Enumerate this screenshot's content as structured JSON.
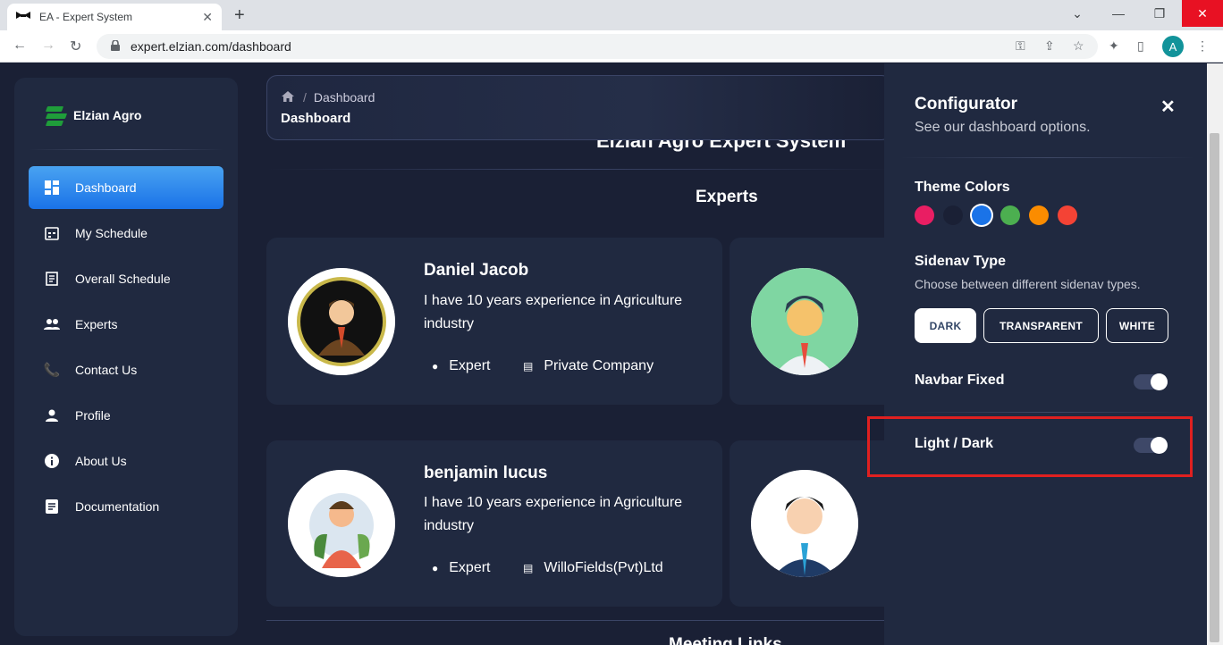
{
  "browser": {
    "tab_title": "EA - Expert System",
    "url": "expert.elzian.com/dashboard",
    "profile_initial": "A"
  },
  "brand": {
    "name": "Elzian Agro"
  },
  "sidebar": {
    "items": [
      {
        "label": "Dashboard",
        "icon": "dashboard-icon",
        "active": true
      },
      {
        "label": "My Schedule",
        "icon": "calendar-icon"
      },
      {
        "label": "Overall Schedule",
        "icon": "receipt-icon"
      },
      {
        "label": "Experts",
        "icon": "people-icon"
      },
      {
        "label": "Contact Us",
        "icon": "phone-icon"
      },
      {
        "label": "Profile",
        "icon": "person-icon"
      },
      {
        "label": "About Us",
        "icon": "info-icon"
      },
      {
        "label": "Documentation",
        "icon": "document-icon"
      }
    ]
  },
  "header": {
    "breadcrumb_current": "Dashboard",
    "page_title": "Dashboard"
  },
  "main": {
    "system_title": "Elzian Agro Expert System",
    "experts_heading": "Experts",
    "meeting_heading": "Meeting Links",
    "experts": [
      {
        "name": "Daniel Jacob",
        "description": "I have 10 years experience in Agriculture industry",
        "role": "Expert",
        "company": "Private Company"
      },
      {
        "name": "benjamin lucus",
        "description": "I have 10 years experience in Agriculture industry",
        "role": "Expert",
        "company": "WilloFields(Pvt)Ltd"
      }
    ]
  },
  "configurator": {
    "title": "Configurator",
    "subtitle": "See our dashboard options.",
    "theme_colors_label": "Theme Colors",
    "theme_colors": [
      "#e91e63",
      "#1a2035",
      "#1A73E8",
      "#4CAF50",
      "#fb8c00",
      "#F44335"
    ],
    "active_theme_index": 2,
    "sidenav_type_label": "Sidenav Type",
    "sidenav_type_hint": "Choose between different sidenav types.",
    "sidenav_types": [
      "DARK",
      "TRANSPARENT",
      "WHITE"
    ],
    "active_sidenav_type": "DARK",
    "navbar_fixed_label": "Navbar Fixed",
    "navbar_fixed": true,
    "light_dark_label": "Light / Dark",
    "dark_mode": true
  }
}
